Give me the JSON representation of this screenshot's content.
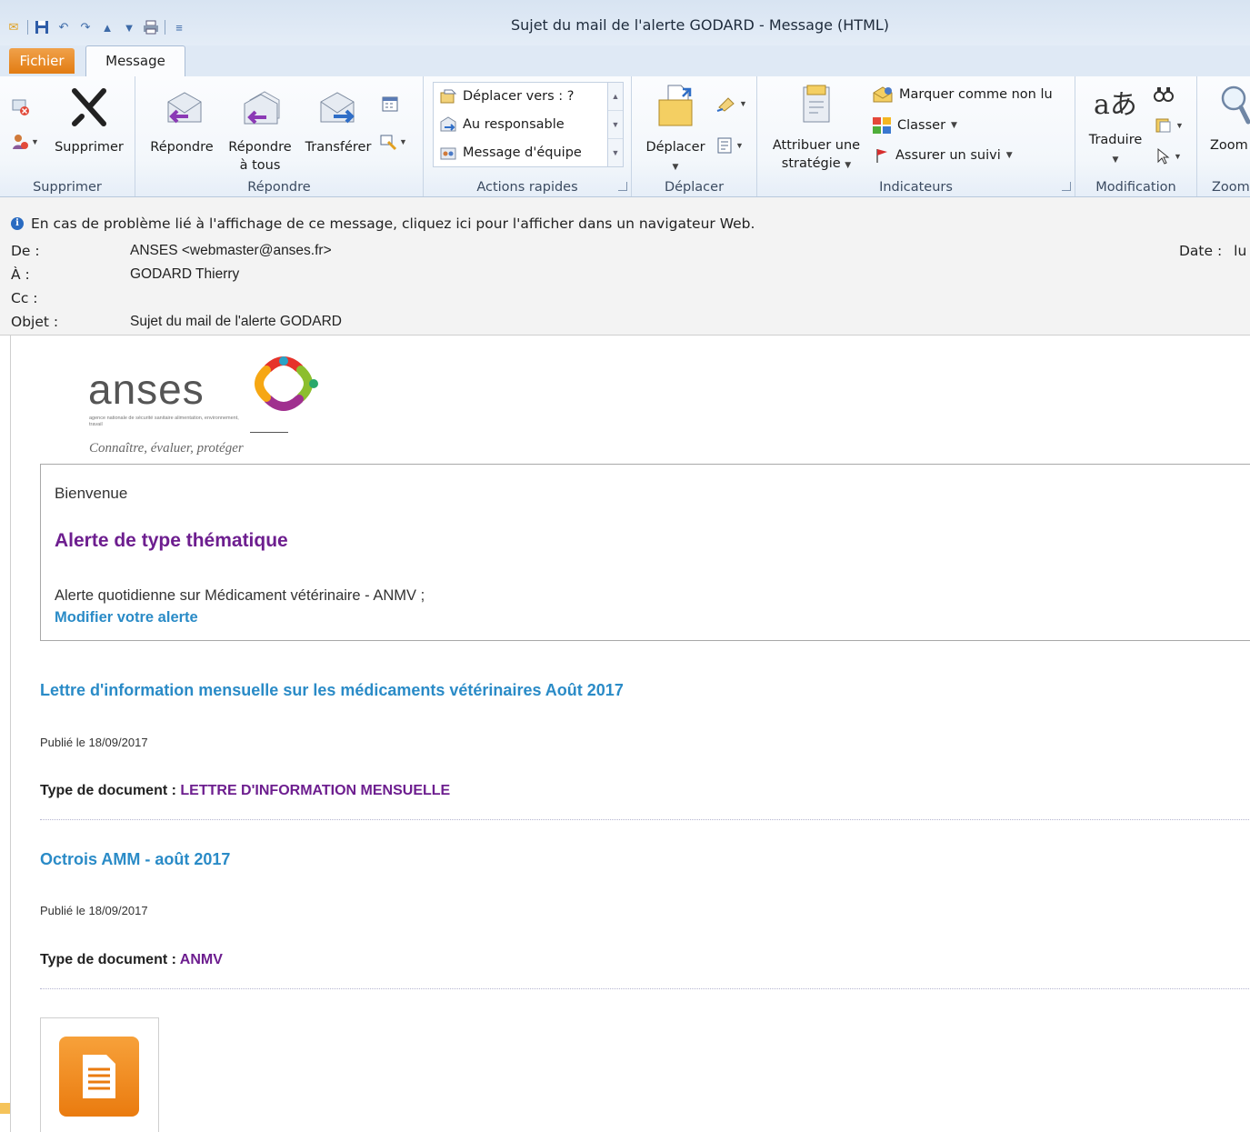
{
  "window": {
    "title": "Sujet du mail de l'alerte GODARD - Message (HTML)"
  },
  "tabs": {
    "file": "Fichier",
    "message": "Message"
  },
  "ribbon": {
    "supprimer": {
      "button": "Supprimer",
      "group": "Supprimer"
    },
    "repondre": {
      "reply": "Répondre",
      "reply_all_1": "Répondre",
      "reply_all_2": "à tous",
      "forward": "Transférer",
      "group": "Répondre"
    },
    "quick_steps": {
      "items": [
        "Déplacer vers : ?",
        "Au responsable",
        "Message d'équipe"
      ],
      "group": "Actions rapides"
    },
    "deplacer": {
      "button": "Déplacer",
      "group": "Déplacer"
    },
    "indicateurs": {
      "policy_1": "Attribuer une",
      "policy_2": "stratégie",
      "unread": "Marquer comme non lu",
      "categorize": "Classer",
      "followup": "Assurer un suivi",
      "group": "Indicateurs"
    },
    "modification": {
      "translate": "Traduire",
      "group": "Modification"
    },
    "zoom": {
      "button": "Zoom",
      "group": "Zoom"
    }
  },
  "infobar": {
    "text": "En cas de problème lié à l'affichage de ce message, cliquez ici pour l'afficher dans un navigateur Web."
  },
  "headers": {
    "from_label": "De :",
    "from_value": "ANSES <webmaster@anses.fr>",
    "to_label": "À :",
    "to_value": "GODARD Thierry",
    "cc_label": "Cc :",
    "cc_value": "",
    "subject_label": "Objet :",
    "subject_value": "Sujet du mail de l'alerte GODARD",
    "date_label": "Date :",
    "date_value": "lu"
  },
  "email": {
    "logo": {
      "word": "anses",
      "subtitle": "agence nationale de sécurité sanitaire alimentation, environnement, travail",
      "tagline": "Connaître, évaluer, protéger"
    },
    "welcome": "Bienvenue",
    "alert_title": "Alerte de type thématique",
    "alert_desc": "Alerte quotidienne sur Médicament vétérinaire - ANMV ;",
    "modify_link": "Modifier votre alerte",
    "doc_type_label": "Type de document :",
    "articles": [
      {
        "title": "Lettre d'information mensuelle sur les médicaments vétérinaires Août 2017",
        "date": "Publié le 18/09/2017",
        "type": "LETTRE D'INFORMATION MENSUELLE"
      },
      {
        "title": "Octrois AMM - août 2017",
        "date": "Publié le 18/09/2017",
        "type": "ANMV"
      }
    ]
  },
  "colors": {
    "accent_blue": "#2a8bc7",
    "accent_purple": "#6d1e8f",
    "file_tab": "#e27c12"
  }
}
